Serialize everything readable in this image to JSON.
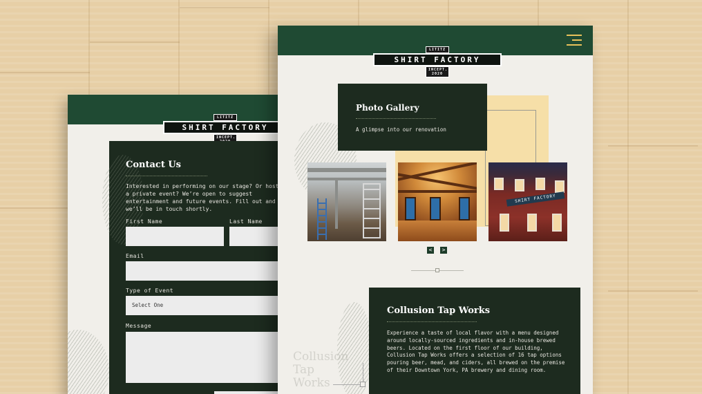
{
  "brand": {
    "logo_top": "LITITZ",
    "logo_main": "SHIRT FACTORY",
    "logo_bottom": "INCEPT. 2020"
  },
  "contact": {
    "title": "Contact Us",
    "intro": "Interested in performing on our stage? Or host a private event? We’re open to suggest entertainment and future events. Fill out and we’ll be in touch shortly.",
    "first_name_label": "First Name",
    "last_name_label": "Last Name",
    "email_label": "Email",
    "event_type_label": "Type of Event",
    "event_type_value": "Select One",
    "message_label": "Message"
  },
  "gallery": {
    "title": "Photo Gallery",
    "subtitle": "A glimpse into our renovation",
    "prev_label": "<",
    "next_label": ">",
    "photo_sign": "SHIRT FACTORY"
  },
  "taproom": {
    "title": "Collusion Tap Works",
    "description": "Experience a taste of local flavor with a menu designed around locally-sourced ingredients and in-house brewed beers. Located on the first floor of our building, Collusion Tap Works offers a selection of 16 tap options pouring beer, mead, and ciders, all brewed on the premise of their Downtown York, PA brewery and dining room.",
    "ghost_line1": "Collusion",
    "ghost_line2": "Tap",
    "ghost_line3": "Works"
  },
  "colors": {
    "header_green": "#1f4a33",
    "panel_dark": "#1d2b1f",
    "accent_gold": "#f6dfa8",
    "menu_gold": "#e8c15a",
    "paper": "#f1efea"
  }
}
